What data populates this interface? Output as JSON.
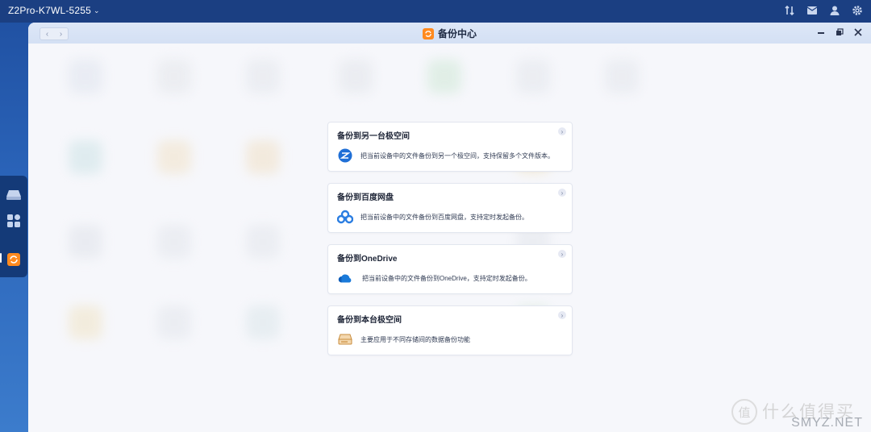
{
  "topbar": {
    "device_name": "Z2Pro-K7WL-5255",
    "icons": [
      "transfer-icon",
      "mail-icon",
      "user-icon",
      "settings-icon"
    ]
  },
  "dock": {
    "items": [
      "storage-icon",
      "apps-icon",
      "backup-center-icon"
    ]
  },
  "window": {
    "title": "备份中心",
    "controls": [
      "minimize-icon",
      "restore-icon",
      "close-icon"
    ]
  },
  "cards": [
    {
      "title": "备份到另一台极空间",
      "desc": "把当前设备中的文件备份到另一个极空间，支持保留多个文件版本。",
      "icon": "zspace-icon"
    },
    {
      "title": "备份到百度网盘",
      "desc": "把当前设备中的文件备份到百度网盘，支持定时发起备份。",
      "icon": "baidu-netdisk-icon"
    },
    {
      "title": "备份到OneDrive",
      "desc": "把当前设备中的文件备份到OneDrive，支持定时发起备份。",
      "icon": "onedrive-icon"
    },
    {
      "title": "备份到本台极空间",
      "desc": "主要应用于不同存储间的数据备份功能",
      "icon": "local-disk-icon"
    }
  ],
  "watermark": {
    "text": "什么值得买",
    "site": "SMYZ.NET",
    "logo_glyph": "值"
  },
  "colors": {
    "accent": "#ff8a1f",
    "topbar": "#1b3f82",
    "window_bg": "#f6f7fb"
  }
}
